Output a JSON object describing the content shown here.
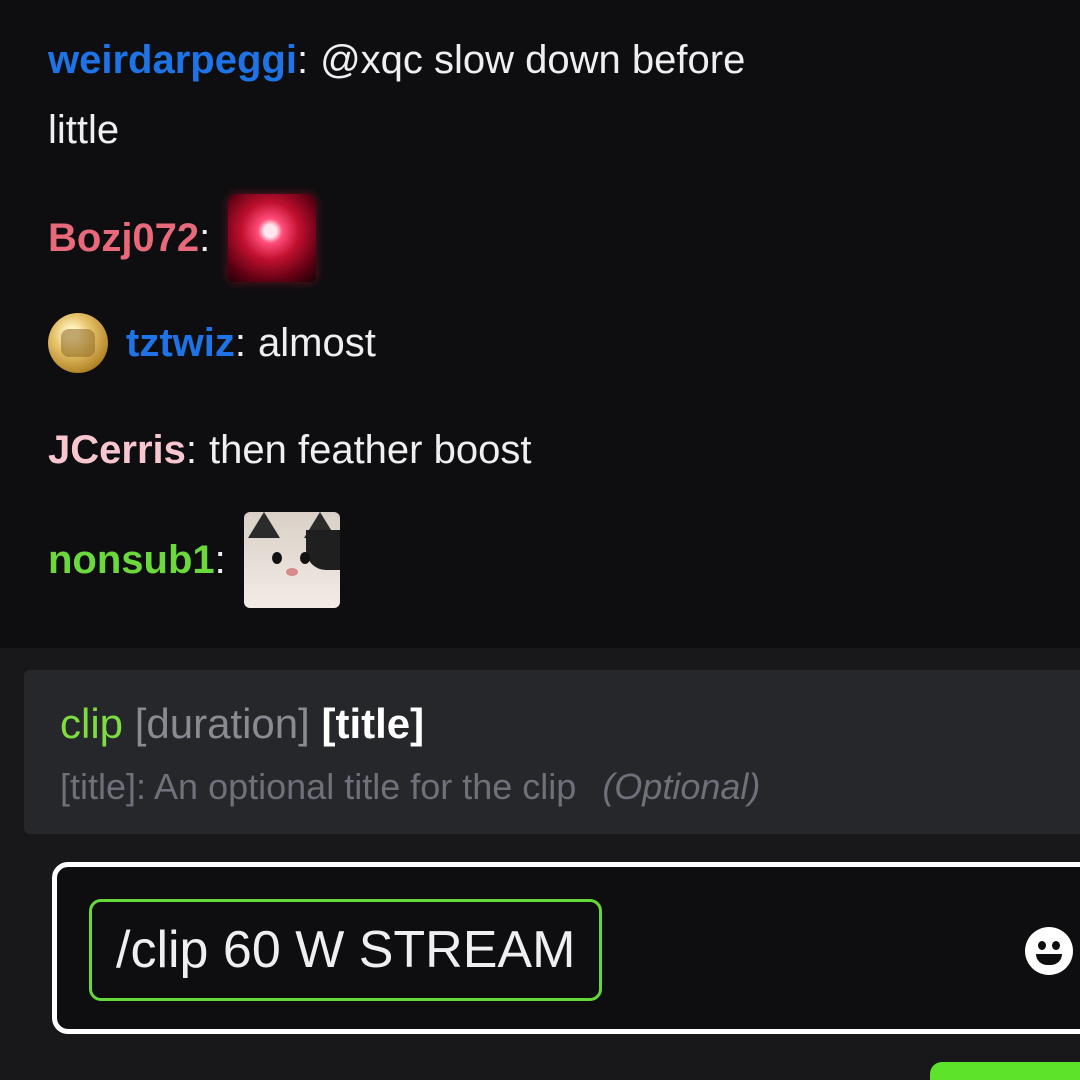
{
  "chat": {
    "messages": [
      {
        "user": "weirdarpeggi",
        "user_color": "#1e74e6",
        "text": "@xqc slow down before",
        "text_cont": "little"
      },
      {
        "user": "Bozj072",
        "user_color": "#e8697a",
        "emote": "siren-emote"
      },
      {
        "user": "tztwiz",
        "user_color": "#1e74e6",
        "badge": "coin-badge",
        "text": "almost"
      },
      {
        "user": "JCerris",
        "user_color": "#f7c6cf",
        "text": "then feather boost"
      },
      {
        "user": "nonsub1",
        "user_color": "#6bd93c",
        "emote": "cat-emote"
      }
    ],
    "colon": ":"
  },
  "command_hint": {
    "command": "clip",
    "arg_duration": "[duration]",
    "arg_title": "[title]",
    "description_label": "[title]:",
    "description": "An optional title for the clip",
    "optional": "(Optional)"
  },
  "composer": {
    "value": "/clip 60 W STREAM",
    "emoji_icon": "smiley-icon"
  }
}
